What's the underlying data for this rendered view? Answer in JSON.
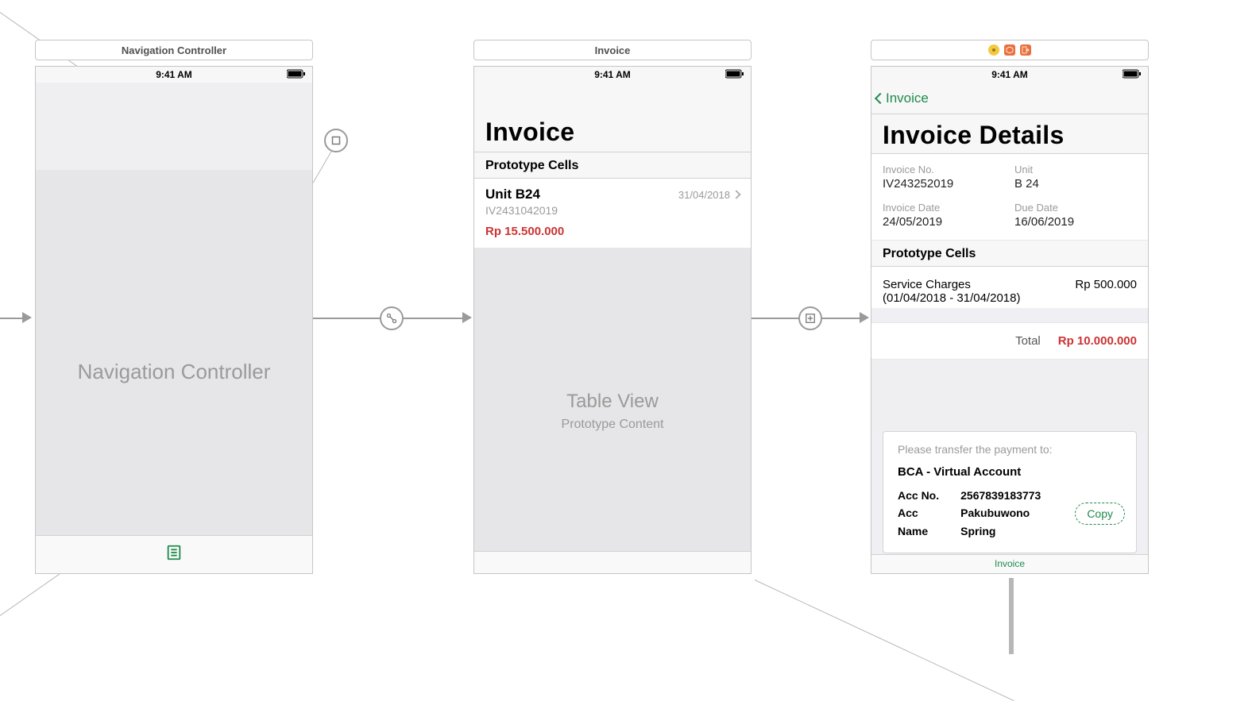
{
  "status_time": "9:41 AM",
  "scenes": {
    "nav": {
      "title": "Navigation Controller",
      "placeholder": "Navigation Controller"
    },
    "invoice": {
      "title": "Invoice",
      "large_title": "Invoice",
      "section_header": "Prototype Cells",
      "cell": {
        "unit": "Unit B24",
        "date": "31/04/2018",
        "invoice_no": "IV2431042019",
        "amount": "Rp 15.500.000"
      },
      "table_placeholder_title": "Table View",
      "table_placeholder_sub": "Prototype Content"
    },
    "details": {
      "back_label": "Invoice",
      "large_title": "Invoice Details",
      "fields": {
        "invoice_no_label": "Invoice No.",
        "invoice_no_value": "IV243252019",
        "unit_label": "Unit",
        "unit_value": "B 24",
        "invoice_date_label": "Invoice Date",
        "invoice_date_value": "24/05/2019",
        "due_date_label": "Due Date",
        "due_date_value": "16/06/2019"
      },
      "section_header": "Prototype Cells",
      "line_item": {
        "desc": "Service Charges (01/04/2018 - 31/04/2018)",
        "amount": "Rp 500.000"
      },
      "total_label": "Total",
      "total_amount": "Rp 10.000.000",
      "payment": {
        "hint": "Please transfer the payment to:",
        "bank": "BCA - Virtual Account",
        "acc_no_label": "Acc No.",
        "acc_no_value": "2567839183773",
        "acc_name_label": "Acc Name",
        "acc_name_value": "Pakubuwono Spring",
        "copy": "Copy"
      },
      "tab_label": "Invoice"
    }
  }
}
